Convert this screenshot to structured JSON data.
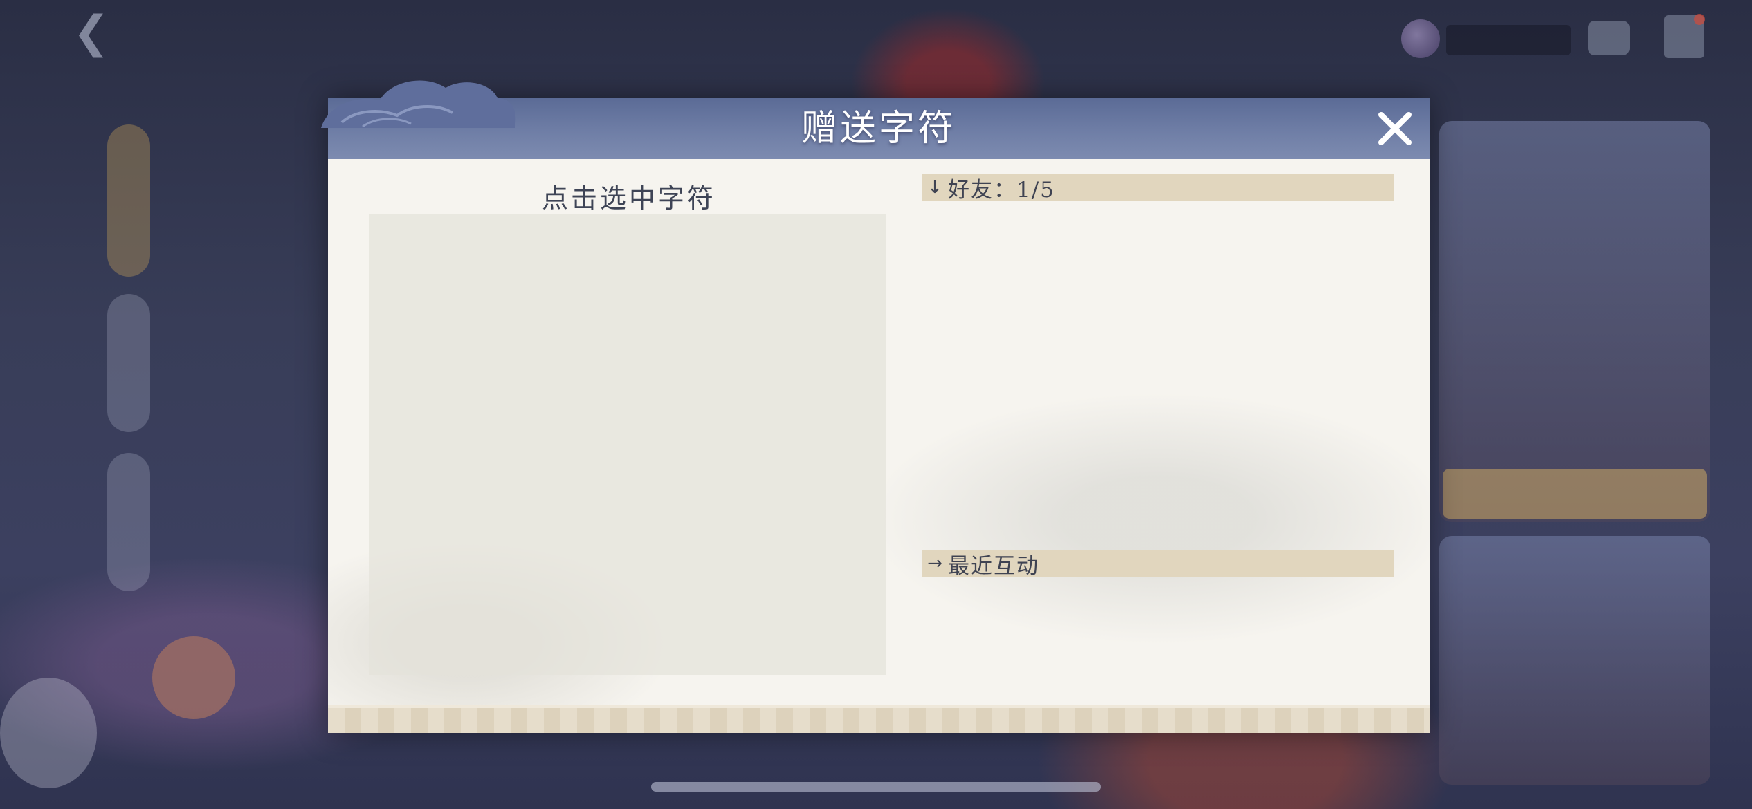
{
  "dialog": {
    "title": "赠送字符",
    "close_icon": "close-x-icon",
    "left_panel": {
      "heading": "点击选中字符"
    },
    "friends_section": {
      "arrow_icon": "arrow-down-icon",
      "label": "好友：1/5"
    },
    "recent_section": {
      "arrow_icon": "arrow-right-icon",
      "label": "最近互动"
    }
  },
  "colors": {
    "header": "#6f7ea6",
    "section_bar": "#e1d6be",
    "panel_bg": "#f6f4ef"
  }
}
